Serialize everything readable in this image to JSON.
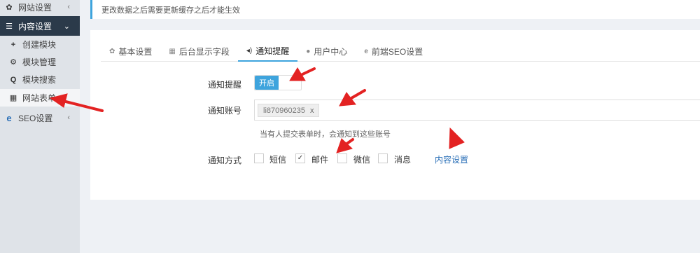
{
  "sidebar": {
    "top_item": {
      "label": "网站设置",
      "icon": "gear-icon"
    },
    "active_group": {
      "label": "内容设置",
      "icon": "menu-icon"
    },
    "sub_items": [
      {
        "label": "创建模块",
        "icon": "plus-icon"
      },
      {
        "label": "模块管理",
        "icon": "cogs-icon"
      },
      {
        "label": "模块搜索",
        "icon": "search-icon"
      },
      {
        "label": "网站表单",
        "icon": "table-icon"
      }
    ],
    "seo_item": {
      "label": "SEO设置",
      "icon": "ie-icon"
    }
  },
  "notice": {
    "text": "更改数据之后需要更新缓存之后才能生效"
  },
  "tabs": [
    {
      "label": "基本设置",
      "icon": "gear-icon"
    },
    {
      "label": "后台显示字段",
      "icon": "table-icon"
    },
    {
      "label": "通知提醒",
      "icon": "volume-icon"
    },
    {
      "label": "用户中心",
      "icon": "user-icon"
    },
    {
      "label": "前端SEO设置",
      "icon": "ie-icon"
    }
  ],
  "form": {
    "notify_label": "通知提醒",
    "toggle_on": "开启",
    "account_label": "通知账号",
    "account_tag": "li870960235",
    "tag_remove": "x",
    "help_text": "当有人提交表单时，会通知到这些账号",
    "method_label": "通知方式",
    "methods": [
      {
        "label": "短信",
        "checked": false
      },
      {
        "label": "邮件",
        "checked": true
      },
      {
        "label": "微信",
        "checked": false
      },
      {
        "label": "消息",
        "checked": false
      }
    ],
    "content_link": "内容设置"
  },
  "colors": {
    "accent": "#3ea4dd",
    "sidebar_active": "#2b3a4a",
    "annotation_arrow": "#e32222"
  }
}
